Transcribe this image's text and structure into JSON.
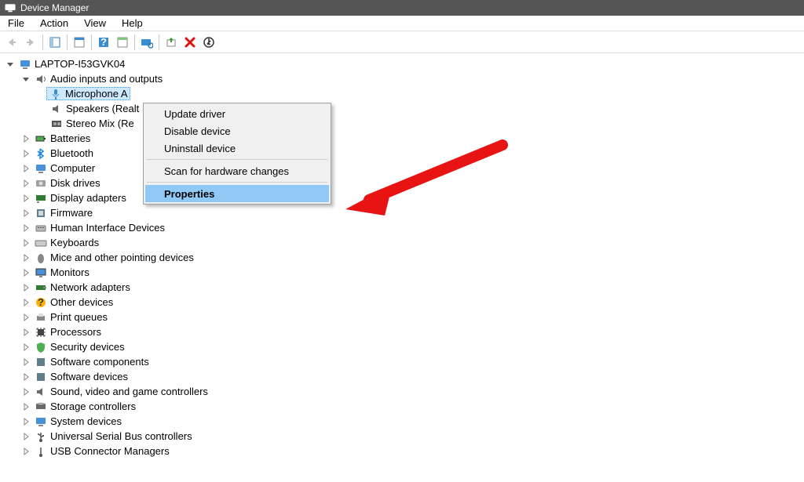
{
  "title": "Device Manager",
  "menu": {
    "file": "File",
    "action": "Action",
    "view": "View",
    "help": "Help"
  },
  "tree": {
    "root": "LAPTOP-I53GVK04",
    "audio": {
      "label": "Audio inputs and outputs",
      "mic": "Microphone A",
      "speakers": "Speakers (Realt",
      "stereo": "Stereo Mix (Re"
    },
    "batteries": "Batteries",
    "bluetooth": "Bluetooth",
    "computer": "Computer",
    "disk": "Disk drives",
    "display": "Display adapters",
    "firmware": "Firmware",
    "hid": "Human Interface Devices",
    "keyboards": "Keyboards",
    "mice": "Mice and other pointing devices",
    "monitors": "Monitors",
    "netadapters": "Network adapters",
    "otherdev": "Other devices",
    "printq": "Print queues",
    "processors": "Processors",
    "securitydev": "Security devices",
    "swcomp": "Software components",
    "swdev": "Software devices",
    "sound": "Sound, video and game controllers",
    "storage": "Storage controllers",
    "sysdev": "System devices",
    "usb": "Universal Serial Bus controllers",
    "usbconn": "USB Connector Managers"
  },
  "context_menu": {
    "update": "Update driver",
    "disable": "Disable device",
    "uninstall": "Uninstall device",
    "scan": "Scan for hardware changes",
    "properties": "Properties"
  }
}
